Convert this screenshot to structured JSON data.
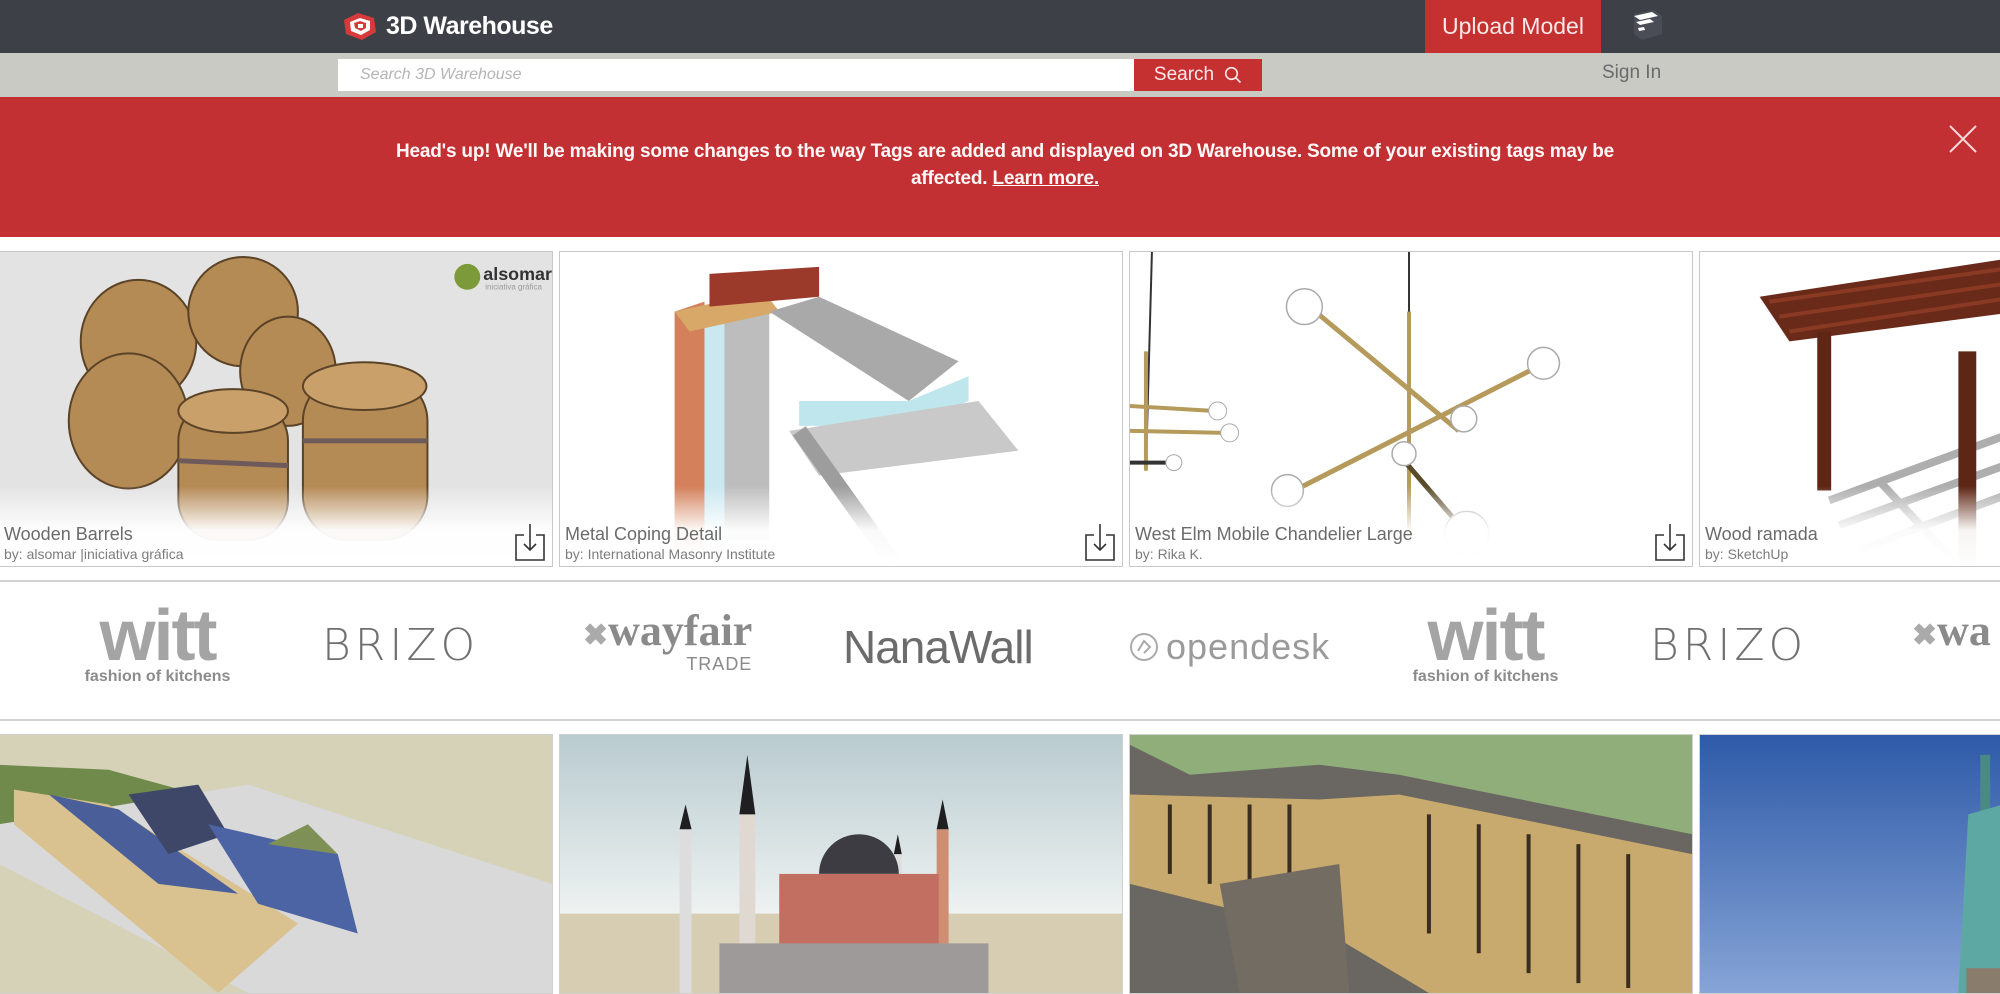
{
  "header": {
    "logo_text": "3D Warehouse",
    "upload_label": "Upload Model",
    "sketchup_icon": "sketchup-icon"
  },
  "search": {
    "placeholder": "Search 3D Warehouse",
    "value": "",
    "button_label": "Search",
    "sign_in_label": "Sign In"
  },
  "banner": {
    "message": "Head's up! We'll be making some changes to the way Tags are added and displayed on 3D Warehouse. Some of your existing tags may be affected.",
    "link_label": "Learn more.",
    "close_icon": "close-icon"
  },
  "featured_models": [
    {
      "title": "Wooden Barrels",
      "author": "by: alsomar |iniciativa gráfica",
      "badge": "alsomar",
      "badge_sub": "iniciativa gráfica"
    },
    {
      "title": "Metal Coping Detail",
      "author": "by: International Masonry Institute"
    },
    {
      "title": "West Elm Mobile Chandelier Large",
      "author": "by: Rika K."
    },
    {
      "title": "Wood ramada",
      "author": "by: SketchUp"
    }
  ],
  "brands": [
    {
      "name": "witt",
      "tagline": "fashion of kitchens"
    },
    {
      "name": "BRIZO"
    },
    {
      "name": "wayfair",
      "tagline": "TRADE"
    },
    {
      "name": "NanaWall"
    },
    {
      "name": "opendesk"
    },
    {
      "name": "witt",
      "tagline": "fashion of kitchens"
    },
    {
      "name": "BRIZO"
    },
    {
      "name": "wa"
    }
  ],
  "colors": {
    "topbar": "#3d4047",
    "accent_red": "#c53030",
    "searchbar": "#cacac5",
    "banner": "#c33033"
  }
}
